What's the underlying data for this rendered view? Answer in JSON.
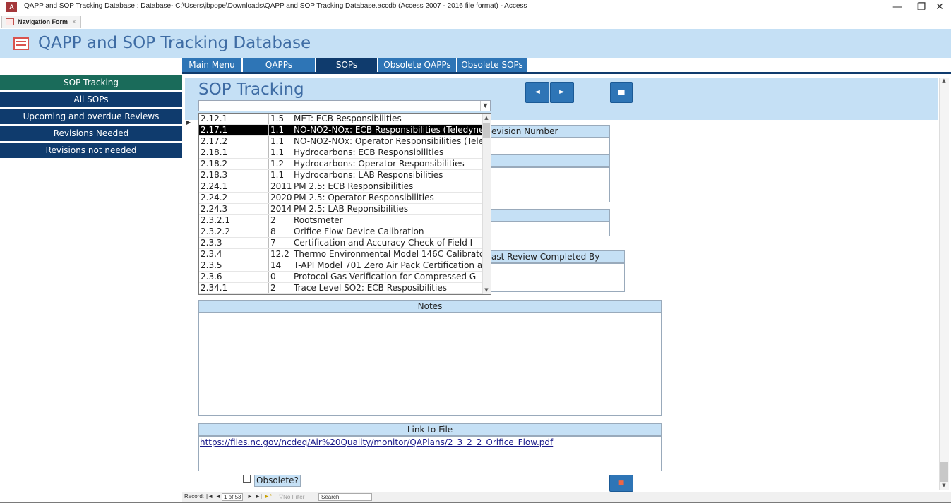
{
  "window": {
    "title": "QAPP and SOP Tracking Database : Database- C:\\Users\\jbpope\\Downloads\\QAPP and SOP Tracking Database.accdb (Access 2007 - 2016 file format) - Access",
    "app_icon_letter": "A",
    "minimize": "—",
    "restore": "❐",
    "close": "✕"
  },
  "doc_tab": {
    "label": "Navigation Form",
    "close": "×"
  },
  "header": {
    "title": "QAPP and SOP Tracking Database"
  },
  "tabs": [
    {
      "label": "Main Menu",
      "active": false
    },
    {
      "label": "QAPPs",
      "active": false
    },
    {
      "label": "SOPs",
      "active": true
    },
    {
      "label": "Obsolete QAPPs",
      "active": false
    },
    {
      "label": "Obsolete SOPs",
      "active": false
    }
  ],
  "sidebar": {
    "items": [
      {
        "label": "SOP Tracking",
        "active": true
      },
      {
        "label": "All SOPs",
        "active": false
      },
      {
        "label": "Upcoming and overdue Reviews",
        "active": false
      },
      {
        "label": "Revisions Needed",
        "active": false
      },
      {
        "label": "Revisions not needed",
        "active": false
      }
    ]
  },
  "form": {
    "title": "SOP Tracking",
    "combo_value": "",
    "prev_icon": "◄",
    "next_icon": "►",
    "record_selector": "▶"
  },
  "dropdown": {
    "rows": [
      {
        "num": "2.12.1",
        "rev": "1.5",
        "name": "MET: ECB Responsibilities",
        "selected": false
      },
      {
        "num": "2.17.1",
        "rev": "1.1",
        "name": "NO-NO2-NOx: ECB Responsibilities (Teledyne",
        "selected": true
      },
      {
        "num": "2.17.2",
        "rev": "1.1",
        "name": "NO-NO2-NOx: Operator Responsibilities (Tele",
        "selected": false
      },
      {
        "num": "2.18.1",
        "rev": "1.1",
        "name": "Hydrocarbons: ECB Responsibilities",
        "selected": false
      },
      {
        "num": "2.18.2",
        "rev": "1.2",
        "name": "Hydrocarbons: Operator Responsibilities",
        "selected": false
      },
      {
        "num": "2.18.3",
        "rev": "1.1",
        "name": "Hydrocarbons: LAB Responsibilities",
        "selected": false
      },
      {
        "num": "2.24.1",
        "rev": "2011",
        "name": "PM 2.5: ECB Responsibilities",
        "selected": false
      },
      {
        "num": "2.24.2",
        "rev": "2020",
        "name": "PM 2.5: Operator Responsibilities",
        "selected": false
      },
      {
        "num": "2.24.3",
        "rev": "2014",
        "name": "PM 2.5: LAB Reponsibilities",
        "selected": false
      },
      {
        "num": "2.3.2.1",
        "rev": "2",
        "name": "Rootsmeter",
        "selected": false
      },
      {
        "num": "2.3.2.2",
        "rev": "8",
        "name": "Orifice Flow Device Calibration",
        "selected": false
      },
      {
        "num": "2.3.3",
        "rev": "7",
        "name": "Certification and Accuracy Check of Field I",
        "selected": false
      },
      {
        "num": "2.3.4",
        "rev": "12.2",
        "name": "Thermo Environmental Model 146C Calibrato",
        "selected": false
      },
      {
        "num": "2.3.5",
        "rev": "14",
        "name": "T-API Model 701 Zero Air Pack Certification a",
        "selected": false
      },
      {
        "num": "2.3.6",
        "rev": "0",
        "name": "Protocol Gas Verification for Compressed G",
        "selected": false
      },
      {
        "num": "2.34.1",
        "rev": "2",
        "name": "Trace Level SO2: ECB Resposibilities",
        "selected": false
      }
    ]
  },
  "fields": {
    "revision_number_label": "evision Number",
    "last_review_label": "ast Review Completed By",
    "notes_label": "Notes",
    "link_label": "Link to File",
    "link_value": "https://files.nc.gov/ncdeq/Air%20Quality/monitor/QAPlans/2_3_2_2_Orifice_Flow.pdf",
    "obsolete_label": "Obsolete?"
  },
  "record_nav": {
    "label": "Record:",
    "first": "|◄",
    "prev": "◄",
    "position": "1 of 53",
    "next": "►",
    "last": "►|",
    "new": "►*",
    "filter": "No Filter",
    "search": "Search"
  }
}
